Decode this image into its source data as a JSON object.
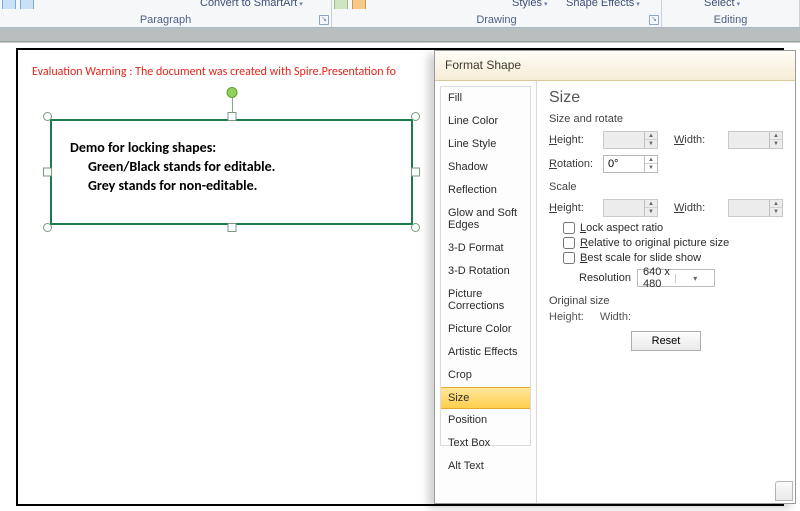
{
  "ribbon": {
    "convert_smartart": "Convert to SmartArt",
    "styles": "Styles",
    "shape_effects": "Shape Effects",
    "select": "Select",
    "groups": {
      "paragraph": "Paragraph",
      "drawing": "Drawing",
      "editing": "Editing"
    }
  },
  "warning": "Evaluation Warning : The document was created with  Spire.Presentation fo",
  "shape": {
    "line1": "Demo for locking shapes:",
    "line2": "Green/Black stands for editable.",
    "line3": "Grey stands for non-editable."
  },
  "dialog": {
    "title": "Format Shape",
    "categories": [
      "Fill",
      "Line Color",
      "Line Style",
      "Shadow",
      "Reflection",
      "Glow and Soft Edges",
      "3-D Format",
      "3-D Rotation",
      "Picture Corrections",
      "Picture Color",
      "Artistic Effects",
      "Crop",
      "Size",
      "Position",
      "Text Box",
      "Alt Text"
    ],
    "selected": "Size",
    "size": {
      "section": "Size",
      "sub_rotate": "Size and rotate",
      "height": "Height:",
      "width": "Width:",
      "rotation": "Rotation:",
      "rotation_val": "0°",
      "sub_scale": "Scale",
      "lock_aspect": "Lock aspect ratio",
      "relative": "Relative to original picture size",
      "best_scale": "Best scale for slide show",
      "resolution": "Resolution",
      "resolution_val": "640 x 480",
      "sub_original": "Original size",
      "orig_height": "Height:",
      "orig_width": "Width:",
      "reset": "Reset"
    }
  }
}
